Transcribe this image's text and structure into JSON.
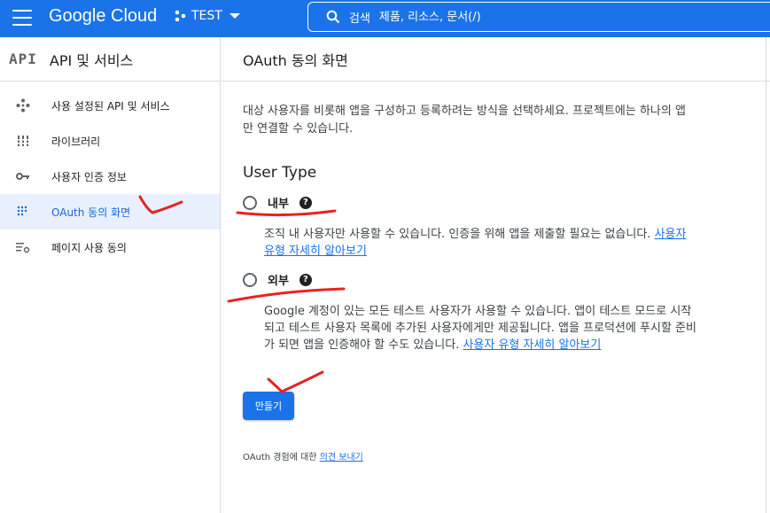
{
  "topbar": {
    "brand": "Google Cloud",
    "project_name": "TEST",
    "search_label": "검색",
    "search_placeholder": "제품, 리소스, 문서(/)"
  },
  "sidebar": {
    "logo_text": "API",
    "title": "API 및 서비스",
    "items": [
      {
        "label": "사용 설정된 API 및 서비스",
        "icon": "diamond-dots-icon",
        "active": false
      },
      {
        "label": "라이브러리",
        "icon": "library-icon",
        "active": false
      },
      {
        "label": "사용자 인증 정보",
        "icon": "key-icon",
        "active": false
      },
      {
        "label": "OAuth 동의 화면",
        "icon": "oauth-dots-icon",
        "active": true
      },
      {
        "label": "페이지 사용 동의",
        "icon": "list-settings-icon",
        "active": false
      }
    ]
  },
  "main": {
    "title": "OAuth 동의 화면",
    "intro": "대상 사용자를 비롯해 앱을 구성하고 등록하려는 방식을 선택하세요. 프로젝트에는 하나의 앱만 연결할 수 있습니다.",
    "user_type_heading": "User Type",
    "options": [
      {
        "label": "내부",
        "description": "조직 내 사용자만 사용할 수 있습니다. 인증을 위해 앱을 제출할 필요는 없습니다.",
        "link": "사용자 유형 자세히 알아보기"
      },
      {
        "label": "외부",
        "description": "Google 계정이 있는 모든 테스트 사용자가 사용할 수 있습니다. 앱이 테스트 모드로 시작되고 테스트 사용자 목록에 추가된 사용자에게만 제공됩니다. 앱을 프로덕션에 푸시할 준비가 되면 앱을 인증해야 할 수도 있습니다.",
        "link": "사용자 유형 자세히 알아보기"
      }
    ],
    "help_glyph": "?",
    "create_button": "만들기",
    "feedback_prefix": "OAuth 경험에 대한",
    "feedback_link": "의견 보내기"
  },
  "colors": {
    "accent": "#1a73e8",
    "active_bg": "#e8f0fe",
    "annotation": "#e8231f"
  }
}
